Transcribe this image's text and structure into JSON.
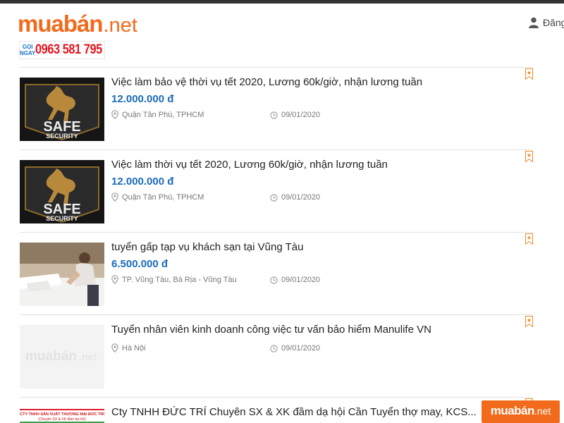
{
  "header": {
    "logo_main": "muabán",
    "logo_tld": ".net",
    "hotline_label_1": "GỌI",
    "hotline_label_2": "NGAY",
    "hotline_number": "0963 581 795",
    "login_label": "Đăng"
  },
  "listings": [
    {
      "title": "Việc làm bảo vệ thời vụ tết 2020, Lương 60k/giờ, nhận lương tuần",
      "price": "12.000.000 đ",
      "location": "Quận Tân Phú, TPHCM",
      "date": "09/01/2020",
      "thumb_text_1": "SAFE",
      "thumb_text_2": "SECURITY"
    },
    {
      "title": "Việc làm thời vụ tết 2020, Lương 60k/giờ, nhận lương tuần",
      "price": "12.000.000 đ",
      "location": "Quận Tân Phú, TPHCM",
      "date": "09/01/2020",
      "thumb_text_1": "SAFE",
      "thumb_text_2": "SECURITY"
    },
    {
      "title": "tuyển gấp tạp vụ khách sạn tại Vũng Tàu",
      "price": "6.500.000 đ",
      "location": "TP. Vũng Tàu, Bà Rịa - Vũng Tàu",
      "date": "09/01/2020"
    },
    {
      "title": "Tuyển nhân viên kinh doanh công việc tư vấn bảo hiểm Manulife VN",
      "location": "Hà Nội",
      "date": "09/01/2020",
      "thumb_text_1": "muabán",
      "thumb_text_2": ".net"
    },
    {
      "title": "Cty TNHH ĐỨC TRÍ Chuyên SX & XK đầm dạ hội Cần Tuyển thợ may, KCS...",
      "thumb_text_1": "CTY TNHH SẢN XUẤT THƯƠNG MẠI ĐỨC TRÍ",
      "thumb_text_2": "(Chuyên SX & XK đầm dạ hội)"
    }
  ],
  "floating_badge": {
    "logo_main": "muabán",
    "logo_tld": ".net"
  },
  "colors": {
    "brand_orange": "#f26b1d",
    "price_blue": "#1a6bb8",
    "hotline_red": "#e4161f"
  }
}
